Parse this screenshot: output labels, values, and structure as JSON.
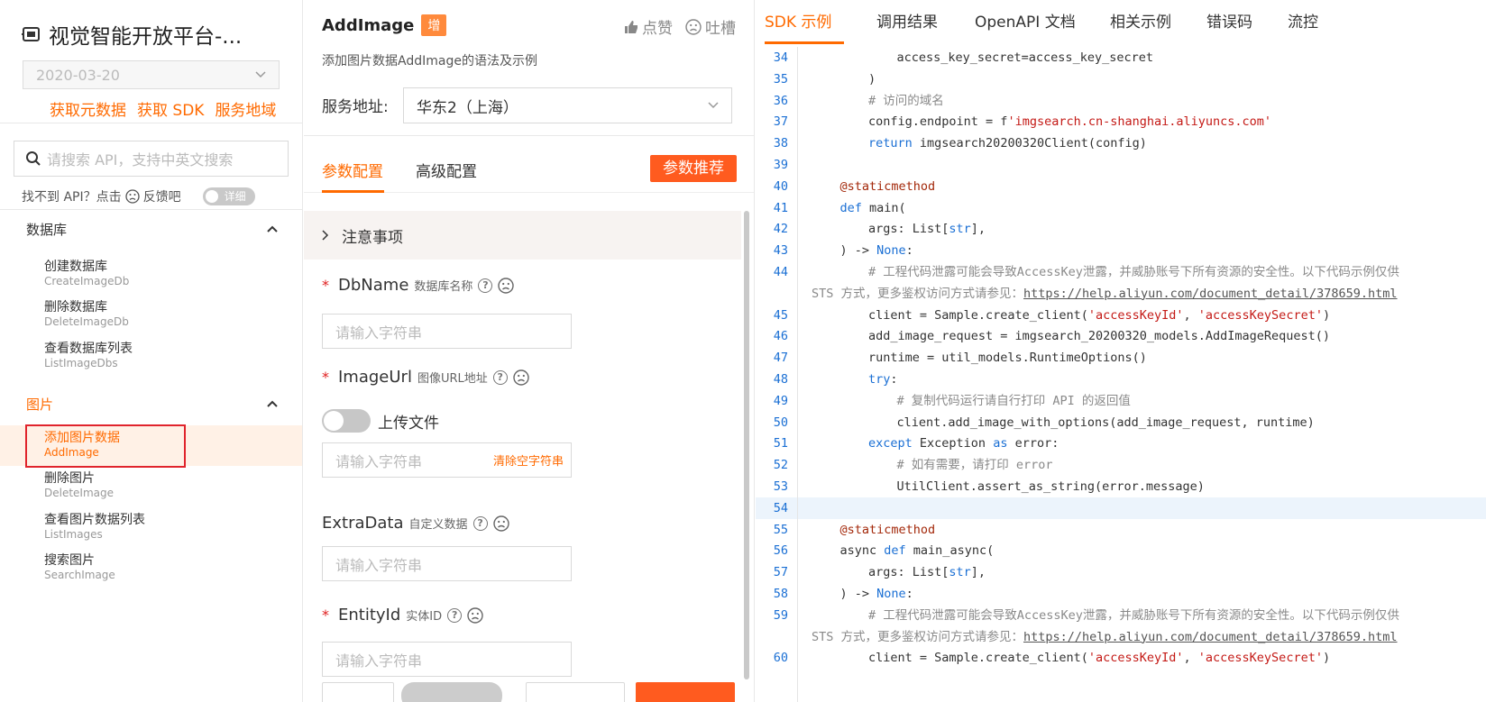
{
  "sidebar": {
    "product_title": "视觉智能开放平台-...",
    "version": "2020-03-20",
    "links": [
      "获取元数据",
      "获取 SDK",
      "服务地域"
    ],
    "search_placeholder": "请搜索 API，支持中英文搜索",
    "feedback_prefix": "找不到 API？点击",
    "feedback_suffix": "反馈吧",
    "detail_toggle_label": "详细",
    "groups": [
      {
        "label": "数据库",
        "items": [
          {
            "zh": "创建数据库",
            "en": "CreateImageDb"
          },
          {
            "zh": "删除数据库",
            "en": "DeleteImageDb"
          },
          {
            "zh": "查看数据库列表",
            "en": "ListImageDbs"
          }
        ]
      },
      {
        "label": "图片",
        "items": [
          {
            "zh": "添加图片数据",
            "en": "AddImage",
            "active": true
          },
          {
            "zh": "删除图片",
            "en": "DeleteImage"
          },
          {
            "zh": "查看图片数据列表",
            "en": "ListImages"
          },
          {
            "zh": "搜索图片",
            "en": "SearchImage"
          }
        ]
      }
    ]
  },
  "api": {
    "name": "AddImage",
    "badge": "增",
    "like_label": "点赞",
    "complain_label": "吐槽",
    "description": "添加图片数据AddImage的语法及示例",
    "service_label": "服务地址:",
    "service_value": "华东2（上海）",
    "tabs": [
      "参数配置",
      "高级配置"
    ],
    "recommend_button": "参数推荐",
    "notice_label": "注意事项",
    "fields": [
      {
        "name": "DbName",
        "desc": "数据库名称",
        "required": true,
        "placeholder": "请输入字符串"
      },
      {
        "name": "ImageUrl",
        "desc": "图像URL地址",
        "required": true,
        "placeholder": "请输入字符串",
        "upload_label": "上传文件",
        "clear_label": "清除空字符串"
      },
      {
        "name": "ExtraData",
        "desc": "自定义数据",
        "required": false,
        "placeholder": "请输入字符串"
      },
      {
        "name": "EntityId",
        "desc": "实体ID",
        "required": true,
        "placeholder": "请输入字符串"
      }
    ]
  },
  "right_tabs": [
    "SDK 示例",
    "调用结果",
    "OpenAPI 文档",
    "相关示例",
    "错误码",
    "流控"
  ],
  "code_lines": [
    {
      "n": "34",
      "indent": 3,
      "parts": [
        [
          "",
          "access_key_secret=access_key_secret"
        ]
      ]
    },
    {
      "n": "35",
      "indent": 2,
      "parts": [
        [
          "",
          ")"
        ]
      ]
    },
    {
      "n": "36",
      "indent": 2,
      "parts": [
        [
          "cm",
          "# 访问的域名"
        ]
      ]
    },
    {
      "n": "37",
      "indent": 2,
      "parts": [
        [
          "",
          "config.endpoint = f"
        ],
        [
          "st",
          "'imgsearch.cn-shanghai.aliyuncs.com'"
        ]
      ]
    },
    {
      "n": "38",
      "indent": 2,
      "parts": [
        [
          "kw",
          "return"
        ],
        [
          "",
          " imgsearch20200320Client(config)"
        ]
      ]
    },
    {
      "n": "39",
      "indent": 0,
      "parts": []
    },
    {
      "n": "40",
      "indent": 1,
      "parts": [
        [
          "dc",
          "@staticmethod"
        ]
      ]
    },
    {
      "n": "41",
      "indent": 1,
      "parts": [
        [
          "kw",
          "def"
        ],
        [
          "",
          " main("
        ]
      ]
    },
    {
      "n": "42",
      "indent": 2,
      "parts": [
        [
          "",
          "args: List["
        ],
        [
          "kw",
          "str"
        ],
        [
          "",
          "],"
        ]
      ]
    },
    {
      "n": "43",
      "indent": 1,
      "parts": [
        [
          "",
          ") -> "
        ],
        [
          "kw",
          "None"
        ],
        [
          "",
          ":"
        ]
      ]
    },
    {
      "n": "44",
      "indent": 2,
      "parts": [
        [
          "cm",
          "# 工程代码泄露可能会导致AccessKey泄露，并威胁账号下所有资源的安全性。以下代码示例仅供"
        ]
      ]
    },
    {
      "n": "",
      "indent": 0,
      "parts": [
        [
          "cm",
          "STS 方式，更多鉴权访问方式请参见："
        ],
        [
          "lk",
          "https://help.aliyun.com/document_detail/378659.html"
        ]
      ]
    },
    {
      "n": "45",
      "indent": 2,
      "parts": [
        [
          "",
          "client = Sample.create_client("
        ],
        [
          "st",
          "'accessKeyId'"
        ],
        [
          "",
          ", "
        ],
        [
          "st",
          "'accessKeySecret'"
        ],
        [
          "",
          ")"
        ]
      ]
    },
    {
      "n": "46",
      "indent": 2,
      "parts": [
        [
          "",
          "add_image_request = imgsearch_20200320_models.AddImageRequest()"
        ]
      ]
    },
    {
      "n": "47",
      "indent": 2,
      "parts": [
        [
          "",
          "runtime = util_models.RuntimeOptions()"
        ]
      ]
    },
    {
      "n": "48",
      "indent": 2,
      "parts": [
        [
          "kw",
          "try"
        ],
        [
          "",
          ":"
        ]
      ]
    },
    {
      "n": "49",
      "indent": 3,
      "parts": [
        [
          "cm",
          "# 复制代码运行请自行打印 API 的返回值"
        ]
      ]
    },
    {
      "n": "50",
      "indent": 3,
      "parts": [
        [
          "",
          "client.add_image_with_options(add_image_request, runtime)"
        ]
      ]
    },
    {
      "n": "51",
      "indent": 2,
      "parts": [
        [
          "kw",
          "except"
        ],
        [
          "",
          " Exception "
        ],
        [
          "kw",
          "as"
        ],
        [
          "",
          " error:"
        ]
      ]
    },
    {
      "n": "52",
      "indent": 3,
      "parts": [
        [
          "cm",
          "# 如有需要，请打印 error"
        ]
      ]
    },
    {
      "n": "53",
      "indent": 3,
      "parts": [
        [
          "",
          "UtilClient.assert_as_string(error.message)"
        ]
      ]
    },
    {
      "n": "54",
      "indent": 0,
      "parts": [],
      "highlight": true
    },
    {
      "n": "55",
      "indent": 1,
      "parts": [
        [
          "dc",
          "@staticmethod"
        ]
      ]
    },
    {
      "n": "56",
      "indent": 1,
      "parts": [
        [
          "",
          "async "
        ],
        [
          "kw",
          "def"
        ],
        [
          "",
          " main_async("
        ]
      ]
    },
    {
      "n": "57",
      "indent": 2,
      "parts": [
        [
          "",
          "args: List["
        ],
        [
          "kw",
          "str"
        ],
        [
          "",
          "],"
        ]
      ]
    },
    {
      "n": "58",
      "indent": 1,
      "parts": [
        [
          "",
          ") -> "
        ],
        [
          "kw",
          "None"
        ],
        [
          "",
          ":"
        ]
      ]
    },
    {
      "n": "59",
      "indent": 2,
      "parts": [
        [
          "cm",
          "# 工程代码泄露可能会导致AccessKey泄露，并威胁账号下所有资源的安全性。以下代码示例仅供"
        ]
      ]
    },
    {
      "n": "",
      "indent": 0,
      "parts": [
        [
          "cm",
          "STS 方式，更多鉴权访问方式请参见："
        ],
        [
          "lk",
          "https://help.aliyun.com/document_detail/378659.html"
        ]
      ]
    },
    {
      "n": "60",
      "indent": 2,
      "parts": [
        [
          "",
          "client = Sample.create_client("
        ],
        [
          "st",
          "'accessKeyId'"
        ],
        [
          "",
          ", "
        ],
        [
          "st",
          "'accessKeySecret'"
        ],
        [
          "",
          ")"
        ]
      ]
    }
  ],
  "colors": {
    "accent": "#ff6a00",
    "keyword": "#1a6fd4",
    "string": "#c41a16",
    "comment": "#8a8a8a",
    "highlight": "#e0242c"
  }
}
